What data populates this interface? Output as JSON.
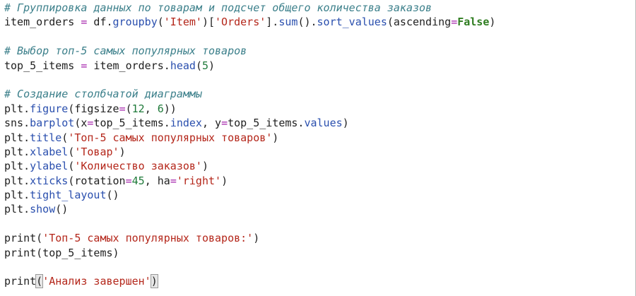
{
  "editor": {
    "lines": [
      [
        {
          "t": "# Группировка данных по товарам и подсчет общего количества заказов",
          "c": "comment"
        }
      ],
      [
        {
          "t": "item_orders ",
          "c": ""
        },
        {
          "t": "=",
          "c": "op"
        },
        {
          "t": " df.",
          "c": ""
        },
        {
          "t": "groupby",
          "c": "fn"
        },
        {
          "t": "(",
          "c": ""
        },
        {
          "t": "'Item'",
          "c": "str"
        },
        {
          "t": ")[",
          "c": ""
        },
        {
          "t": "'Orders'",
          "c": "str"
        },
        {
          "t": "].",
          "c": ""
        },
        {
          "t": "sum",
          "c": "fn"
        },
        {
          "t": "().",
          "c": ""
        },
        {
          "t": "sort_values",
          "c": "fn"
        },
        {
          "t": "(ascending",
          "c": ""
        },
        {
          "t": "=",
          "c": "op"
        },
        {
          "t": "False",
          "c": "kw"
        },
        {
          "t": ")",
          "c": ""
        }
      ],
      [],
      [
        {
          "t": "# Выбор топ-5 самых популярных товаров",
          "c": "comment"
        }
      ],
      [
        {
          "t": "top_5_items ",
          "c": ""
        },
        {
          "t": "=",
          "c": "op"
        },
        {
          "t": " item_orders.",
          "c": ""
        },
        {
          "t": "head",
          "c": "fn"
        },
        {
          "t": "(",
          "c": ""
        },
        {
          "t": "5",
          "c": "num"
        },
        {
          "t": ")",
          "c": ""
        }
      ],
      [],
      [
        {
          "t": "# Создание столбчатой диаграммы",
          "c": "comment"
        }
      ],
      [
        {
          "t": "plt.",
          "c": ""
        },
        {
          "t": "figure",
          "c": "fn"
        },
        {
          "t": "(figsize",
          "c": ""
        },
        {
          "t": "=",
          "c": "op"
        },
        {
          "t": "(",
          "c": ""
        },
        {
          "t": "12",
          "c": "num"
        },
        {
          "t": ", ",
          "c": ""
        },
        {
          "t": "6",
          "c": "num"
        },
        {
          "t": "))",
          "c": ""
        }
      ],
      [
        {
          "t": "sns.",
          "c": ""
        },
        {
          "t": "barplot",
          "c": "fn"
        },
        {
          "t": "(x",
          "c": ""
        },
        {
          "t": "=",
          "c": "op"
        },
        {
          "t": "top_5_items.",
          "c": ""
        },
        {
          "t": "index",
          "c": "attr"
        },
        {
          "t": ", y",
          "c": ""
        },
        {
          "t": "=",
          "c": "op"
        },
        {
          "t": "top_5_items.",
          "c": ""
        },
        {
          "t": "values",
          "c": "attr"
        },
        {
          "t": ")",
          "c": ""
        }
      ],
      [
        {
          "t": "plt.",
          "c": ""
        },
        {
          "t": "title",
          "c": "fn"
        },
        {
          "t": "(",
          "c": ""
        },
        {
          "t": "'Топ-5 самых популярных товаров'",
          "c": "str"
        },
        {
          "t": ")",
          "c": ""
        }
      ],
      [
        {
          "t": "plt.",
          "c": ""
        },
        {
          "t": "xlabel",
          "c": "fn"
        },
        {
          "t": "(",
          "c": ""
        },
        {
          "t": "'Товар'",
          "c": "str"
        },
        {
          "t": ")",
          "c": ""
        }
      ],
      [
        {
          "t": "plt.",
          "c": ""
        },
        {
          "t": "ylabel",
          "c": "fn"
        },
        {
          "t": "(",
          "c": ""
        },
        {
          "t": "'Количество заказов'",
          "c": "str"
        },
        {
          "t": ")",
          "c": ""
        }
      ],
      [
        {
          "t": "plt.",
          "c": ""
        },
        {
          "t": "xticks",
          "c": "fn"
        },
        {
          "t": "(rotation",
          "c": ""
        },
        {
          "t": "=",
          "c": "op"
        },
        {
          "t": "45",
          "c": "num"
        },
        {
          "t": ", ha",
          "c": ""
        },
        {
          "t": "=",
          "c": "op"
        },
        {
          "t": "'right'",
          "c": "str"
        },
        {
          "t": ")",
          "c": ""
        }
      ],
      [
        {
          "t": "plt.",
          "c": ""
        },
        {
          "t": "tight_layout",
          "c": "fn"
        },
        {
          "t": "()",
          "c": ""
        }
      ],
      [
        {
          "t": "plt.",
          "c": ""
        },
        {
          "t": "show",
          "c": "fn"
        },
        {
          "t": "()",
          "c": ""
        }
      ],
      [],
      [
        {
          "t": "print(",
          "c": ""
        },
        {
          "t": "'Топ-5 самых популярных товаров:'",
          "c": "str"
        },
        {
          "t": ")",
          "c": ""
        }
      ],
      [
        {
          "t": "print(top_5_items)",
          "c": ""
        }
      ],
      [],
      [
        {
          "t": "print",
          "c": ""
        },
        {
          "t": "(",
          "c": "bracket-match"
        },
        {
          "t": "'Анализ завершен'",
          "c": "str"
        },
        {
          "t": ")",
          "c": "bracket-match"
        },
        {
          "t": "|CURSOR|",
          "c": "cursor"
        }
      ]
    ]
  }
}
